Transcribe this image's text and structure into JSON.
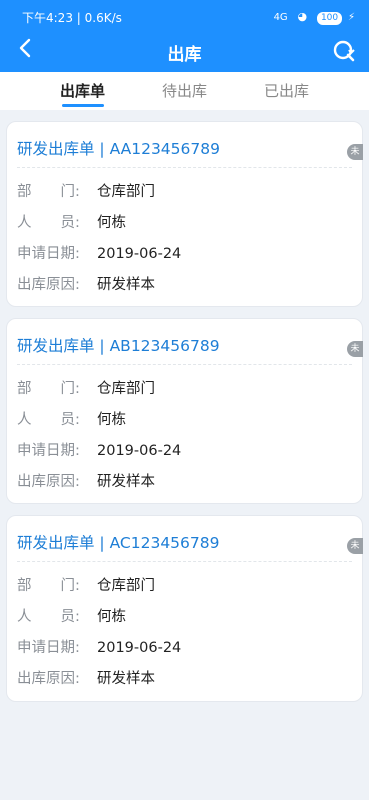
{
  "status_bar": {
    "time_net": "下午4:23 | 0.6K/s",
    "signal": "4G",
    "battery": "100"
  },
  "header": {
    "title": "出库"
  },
  "tabs": [
    {
      "label": "出库单",
      "active": true
    },
    {
      "label": "待出库",
      "active": false
    },
    {
      "label": "已出库",
      "active": false
    }
  ],
  "labels": {
    "department": "部　　门:",
    "person": "人　　员:",
    "date": "申请日期:",
    "reason": "出库原因:"
  },
  "cards": [
    {
      "title": "研发出库单 | AA123456789",
      "badge": "未",
      "department": "仓库部门",
      "person": "何栋",
      "date": "2019-06-24",
      "reason": "研发样本"
    },
    {
      "title": "研发出库单 | AB123456789",
      "badge": "未",
      "department": "仓库部门",
      "person": "何栋",
      "date": "2019-06-24",
      "reason": "研发样本"
    },
    {
      "title": "研发出库单 | AC123456789",
      "badge": "未",
      "department": "仓库部门",
      "person": "何栋",
      "date": "2019-06-24",
      "reason": "研发样本"
    }
  ],
  "colors": {
    "brand": "#1e90ff",
    "title_text": "#1e7ed6",
    "badge": "#9aa0a6"
  },
  "icons": {
    "back": "chevron-left-icon",
    "refresh": "refresh-icon"
  }
}
